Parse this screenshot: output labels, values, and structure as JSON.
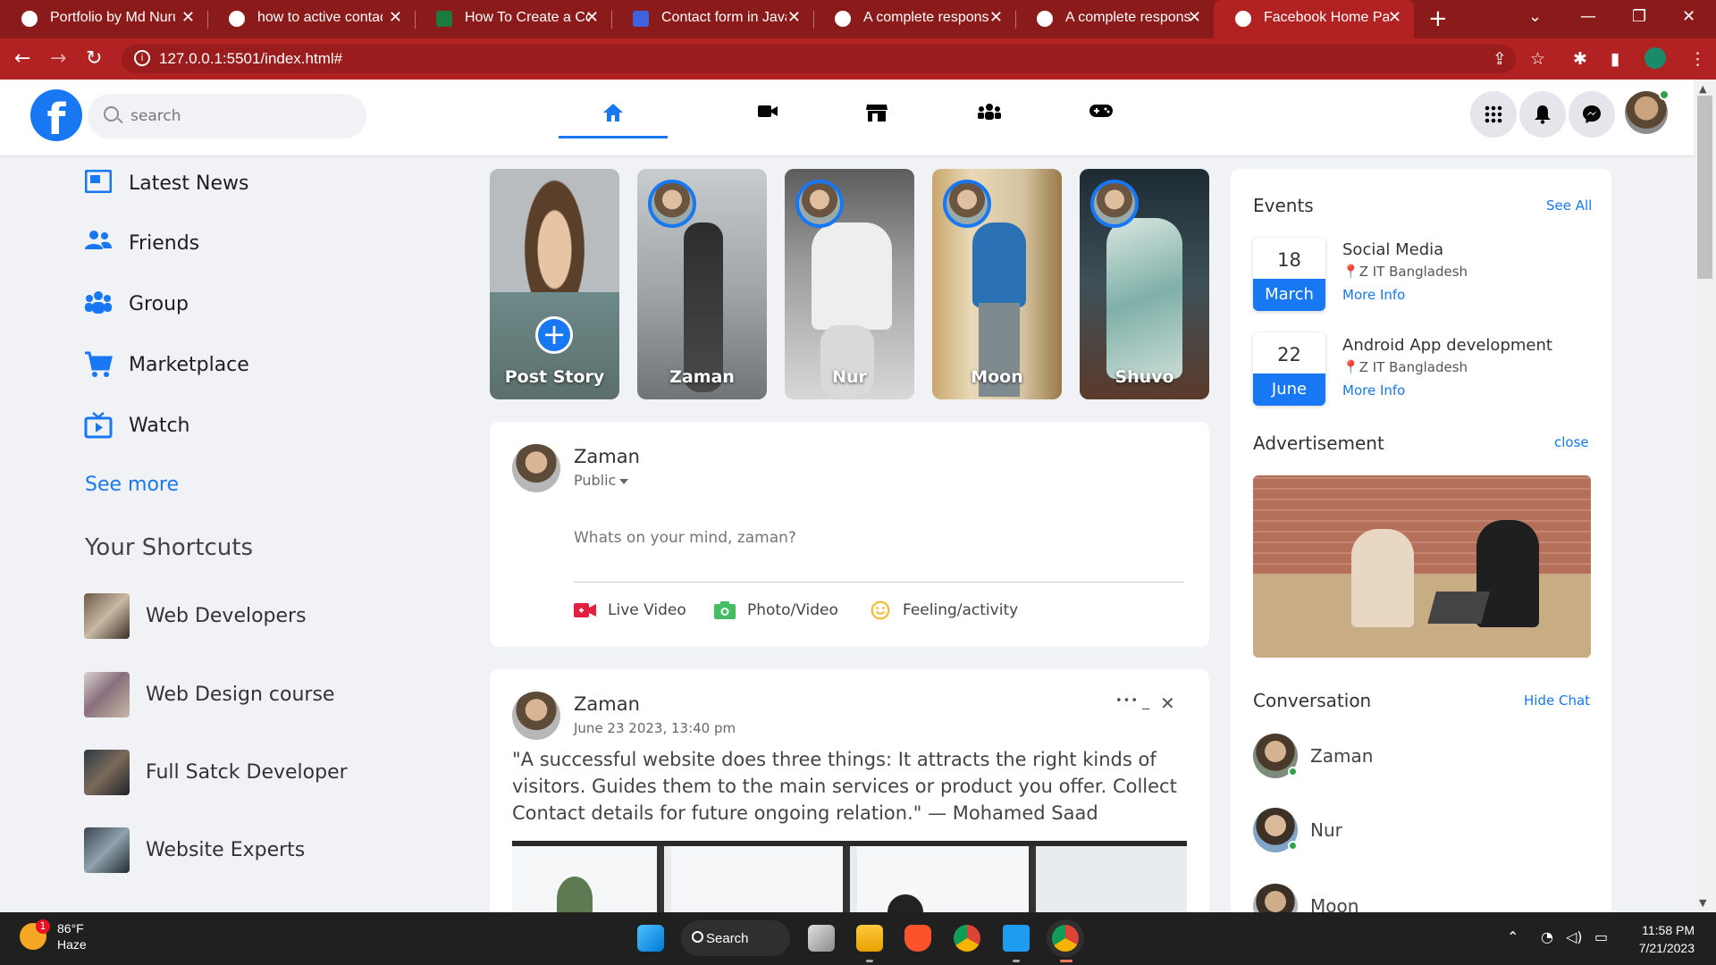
{
  "browser": {
    "tabs": [
      {
        "title": "Portfolio by Md Nuruz"
      },
      {
        "title": "how to active contact"
      },
      {
        "title": "How To Create a Cont"
      },
      {
        "title": "Contact form in JavaS"
      },
      {
        "title": "A complete responsiv"
      },
      {
        "title": "A complete responsiv"
      },
      {
        "title": "Facebook Home Page"
      }
    ],
    "active_tab": 6,
    "url": "127.0.0.1:5501/index.html#",
    "colors": {
      "tabbar": "#8b1a1a",
      "toolbar": "#b22222"
    }
  },
  "header": {
    "logo": "f",
    "search_placeholder": "search",
    "nav_icons": [
      "home-icon",
      "video-icon",
      "marketplace-icon",
      "groups-icon",
      "gaming-icon"
    ],
    "right_icons": [
      "menu-grid-icon",
      "bell-icon",
      "messenger-icon"
    ]
  },
  "sidebar": {
    "items": [
      {
        "label": "Latest News",
        "icon": "news-icon"
      },
      {
        "label": "Friends",
        "icon": "friends-icon"
      },
      {
        "label": "Group",
        "icon": "group-icon"
      },
      {
        "label": "Marketplace",
        "icon": "cart-icon"
      },
      {
        "label": "Watch",
        "icon": "tv-icon"
      }
    ],
    "see_more": "See more",
    "shortcuts_title": "Your Shortcuts",
    "shortcuts": [
      {
        "label": "Web Developers"
      },
      {
        "label": "Web Design course"
      },
      {
        "label": "Full Satck Developer"
      },
      {
        "label": "Website Experts"
      }
    ]
  },
  "stories": [
    {
      "name": "Post Story"
    },
    {
      "name": "Zaman"
    },
    {
      "name": "Nur"
    },
    {
      "name": "Moon"
    },
    {
      "name": "Shuvo"
    }
  ],
  "composer": {
    "name": "Zaman",
    "privacy": "Public",
    "placeholder": "Whats on your mind, zaman?",
    "actions": [
      {
        "label": "Live Video",
        "color": "#e41e3f"
      },
      {
        "label": "Photo/Video",
        "color": "#45bd62"
      },
      {
        "label": "Feeling/activity",
        "color": "#f7b928"
      }
    ]
  },
  "post": {
    "name": "Zaman",
    "date": "June 23 2023, 13:40 pm",
    "more": "•••",
    "minimize": "_",
    "close": "✕",
    "text": "\"A successful website does three things: It attracts the right kinds of visitors. Guides them to the main services or product you offer. Collect Contact details for future ongoing relation.\" — Mohamed Saad"
  },
  "events": {
    "title": "Events",
    "see_all": "See All",
    "items": [
      {
        "day": "18",
        "month": "March",
        "title": "Social Media",
        "location": "Z IT Bangladesh",
        "more": "More Info"
      },
      {
        "day": "22",
        "month": "June",
        "title": "Android App development",
        "location": "Z IT Bangladesh",
        "more": "More Info"
      }
    ]
  },
  "advertisement": {
    "title": "Advertisement",
    "close": "close"
  },
  "conversation": {
    "title": "Conversation",
    "hide": "Hide Chat",
    "items": [
      {
        "name": "Zaman",
        "online": true
      },
      {
        "name": "Nur",
        "online": true
      },
      {
        "name": "Moon",
        "online": false
      }
    ]
  },
  "taskbar": {
    "weather_temp": "86°F",
    "weather_desc": "Haze",
    "weather_badge": "1",
    "search_label": "Search",
    "time": "11:58 PM",
    "date": "7/21/2023"
  }
}
